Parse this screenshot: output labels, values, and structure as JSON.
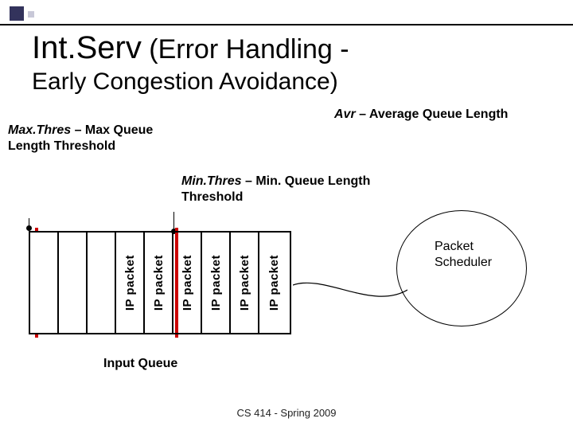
{
  "title": {
    "main_big": "Int.Serv",
    "main_rest": " (Error Handling -",
    "sub": "Early Congestion Avoidance)"
  },
  "labels": {
    "maxthres_ital": "Max.Thres",
    "maxthres_rest": " – Max Queue Length Threshold",
    "avr_ital": "Avr",
    "avr_rest": " – Average Queue Length",
    "minthres_ital": "Min.Thres",
    "minthres_rest": " – Min. Queue Length Threshold",
    "scheduler_l1": "Packet",
    "scheduler_l2": "Scheduler",
    "input_queue": "Input Queue"
  },
  "queue": {
    "packets": [
      "IP packet",
      "IP packet",
      "IP packet",
      "IP packet",
      "IP packet",
      "IP packet"
    ],
    "empty_slots": 3
  },
  "footer": "CS 414 - Spring 2009",
  "chart_data": {
    "type": "diagram",
    "title": "Int.Serv Error Handling - Early Congestion Avoidance (RED thresholds)",
    "annotations": [
      "Max.Thres – Max Queue Length Threshold",
      "Min.Thres – Min. Queue Length Threshold",
      "Avr – Average Queue Length"
    ],
    "components": [
      {
        "name": "Input Queue",
        "slots_total": 9,
        "packets_present": 6,
        "max_threshold_position_slots_from_left": 0,
        "min_threshold_position_slots_from_left": 5
      },
      {
        "name": "Packet Scheduler",
        "shape": "ellipse",
        "connected_from": "Input Queue (head)"
      }
    ]
  }
}
